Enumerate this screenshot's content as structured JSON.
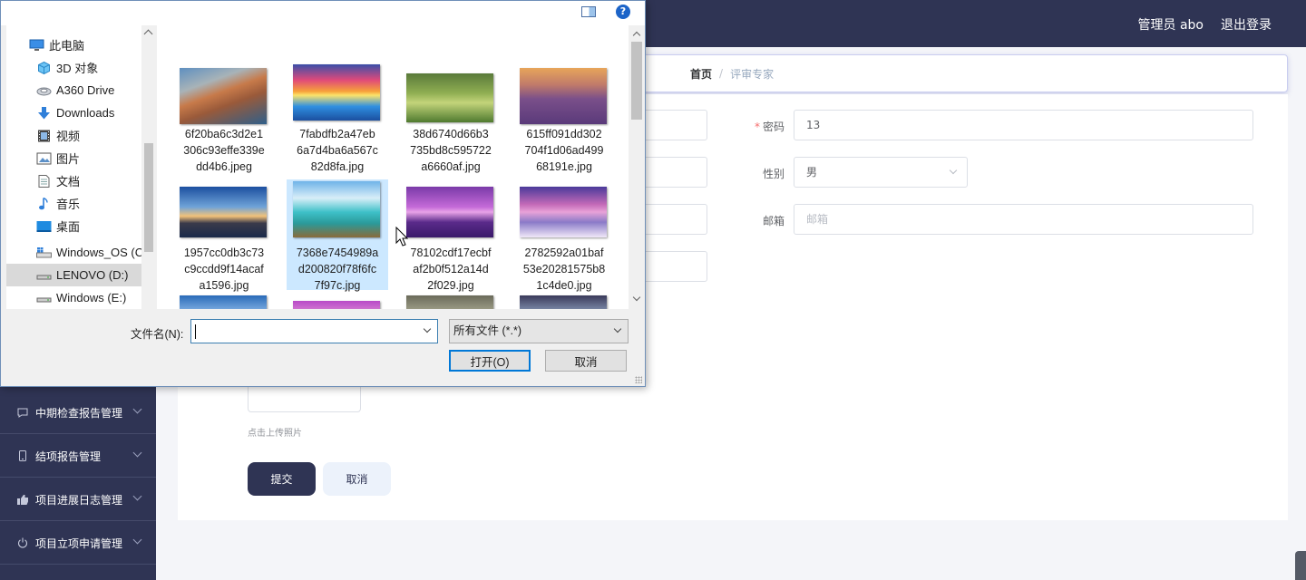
{
  "header": {
    "user": "管理员 abo",
    "logout": "退出登录"
  },
  "breadcrumb": {
    "home": "首页",
    "separator": "/",
    "current": "评审专家"
  },
  "sidebar": {
    "items": [
      {
        "label": "中期检查报告管理",
        "icon": "message-icon"
      },
      {
        "label": "结项报告管理",
        "icon": "phone-icon"
      },
      {
        "label": "项目进展日志管理",
        "icon": "thumb-icon"
      },
      {
        "label": "项目立项申请管理",
        "icon": "power-icon"
      }
    ]
  },
  "form": {
    "password": {
      "label": "密码",
      "value": "13"
    },
    "gender": {
      "label": "性别",
      "value": "男"
    },
    "email": {
      "label": "邮箱",
      "placeholder": "邮箱"
    },
    "upload_tip": "点击上传照片",
    "submit": "提交",
    "cancel": "取消"
  },
  "dialog": {
    "nav": [
      {
        "label": "此电脑",
        "icon": "pc-icon"
      },
      {
        "label": "3D 对象",
        "icon": "3d-objects-icon"
      },
      {
        "label": "A360 Drive",
        "icon": "cloud-drive-icon"
      },
      {
        "label": "Downloads",
        "icon": "download-arrow-icon"
      },
      {
        "label": "视频",
        "icon": "video-icon"
      },
      {
        "label": "图片",
        "icon": "pictures-icon"
      },
      {
        "label": "文档",
        "icon": "document-icon"
      },
      {
        "label": "音乐",
        "icon": "music-icon"
      },
      {
        "label": "桌面",
        "icon": "desktop-icon"
      },
      {
        "label": "Windows_OS (C",
        "icon": "os-drive-icon"
      },
      {
        "label": "LENOVO (D:)",
        "icon": "drive-icon",
        "selected": true
      },
      {
        "label": "Windows (E:)",
        "icon": "drive-icon"
      }
    ],
    "files": [
      {
        "name": "6f20ba6c3d2e1306c93effe339edd4b6.jpeg",
        "lines": [
          "6f20ba6c3d2e1",
          "306c93effe339e",
          "dd4b6.jpeg"
        ]
      },
      {
        "name": "7fabdfb2a47eb6a7d4ba6a567c82d8fa.jpg",
        "lines": [
          "7fabdfb2a47eb",
          "6a7d4ba6a567c",
          "82d8fa.jpg"
        ]
      },
      {
        "name": "38d6740d66b3735bd8c595722a6660af.jpg",
        "lines": [
          "38d6740d66b3",
          "735bd8c595722",
          "a6660af.jpg"
        ]
      },
      {
        "name": "615ff091dd302704f1d06ad49968191e.jpg",
        "lines": [
          "615ff091dd302",
          "704f1d06ad499",
          "68191e.jpg"
        ]
      },
      {
        "name": "1957cc0db3c73c9ccdd9f14acafa1596.jpg",
        "lines": [
          "1957cc0db3c73",
          "c9ccdd9f14acaf",
          "a1596.jpg"
        ]
      },
      {
        "name": "7368e7454989ad200820f78f6fc7f97c.jpg",
        "lines": [
          "7368e7454989a",
          "d200820f78f6fc",
          "7f97c.jpg"
        ],
        "selected": true
      },
      {
        "name": "78102cdf17ecbfaf2b0f512a14d2f029.jpg",
        "lines": [
          "78102cdf17ecbf",
          "af2b0f512a14d",
          "2f029.jpg"
        ]
      },
      {
        "name": "2782592a01baf53e20281575b81c4de0.jpg",
        "lines": [
          "2782592a01baf",
          "53e20281575b8",
          "1c4de0.jpg"
        ]
      }
    ],
    "filename_label": "文件名(N):",
    "filename_value": "",
    "filetype": "所有文件 (*.*)",
    "open": "打开(O)",
    "cancel": "取消",
    "help": "?"
  }
}
